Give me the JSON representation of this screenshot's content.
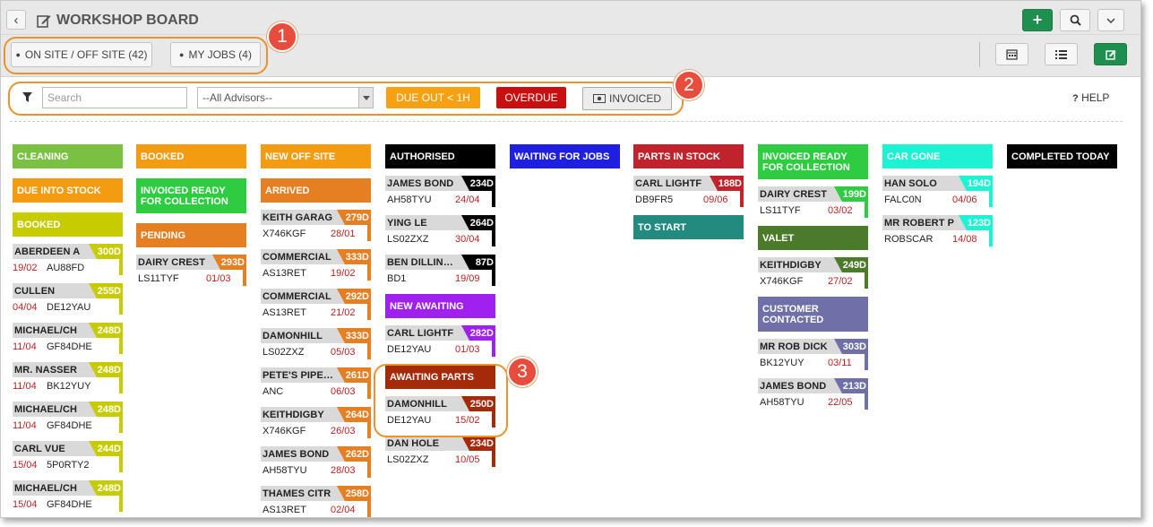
{
  "header": {
    "back_icon": "‹",
    "title": "WORKSHOP BOARD",
    "add_icon": "+",
    "search_icon": "⚲",
    "dropdown_icon": "⌄"
  },
  "tabs": {
    "onsite": "ON SITE / OFF SITE (42)",
    "myjobs": "MY JOBS (4)"
  },
  "view_icons": {
    "calendar": "calendar-icon",
    "list": "list-icon",
    "board": "board-icon"
  },
  "filters": {
    "search_placeholder": "Search",
    "advisors": "--All Advisors--",
    "due_out": "DUE OUT < 1H",
    "overdue": "OVERDUE",
    "invoiced": "INVOICED",
    "help": "HELP"
  },
  "callouts": [
    "1",
    "2",
    "3"
  ],
  "colors": {
    "lime": "#8bc34a",
    "orange": "#f39c12",
    "olive": "#c8c800",
    "green": "#2ecc40",
    "darkorange": "#e67e22",
    "black": "#000000",
    "blue": "#1f1fe0",
    "crimson": "#c0232b",
    "teal": "#238a80",
    "cyan": "#1ef2d4",
    "purple": "#a020f0",
    "darkred": "#a52a0a",
    "darkgreen": "#4a7a2a",
    "slate": "#7070a8"
  },
  "columns": [
    {
      "sections": [
        {
          "title": "CLEANING",
          "color": "#7ac143",
          "cards": []
        },
        {
          "title": "DUE INTO STOCK",
          "color": "#f39c12",
          "cards": []
        },
        {
          "title": "BOOKED",
          "color": "#c7cc00",
          "cards": [
            {
              "name": "ABERDEEN A",
              "days": "300D",
              "date": "19/02",
              "reg": "AU88FD",
              "date_first": true
            },
            {
              "name": "CULLEN",
              "days": "255D",
              "date": "04/04",
              "reg": "DE12YAU",
              "date_first": true
            },
            {
              "name": "MICHAEL/CH",
              "days": "248D",
              "date": "11/04",
              "reg": "GF84DHE",
              "date_first": true
            },
            {
              "name": "MR. NASSER",
              "days": "248D",
              "date": "11/04",
              "reg": "BK12YUY",
              "date_first": true
            },
            {
              "name": "MICHAEL/CH",
              "days": "248D",
              "date": "11/04",
              "reg": "GF84DHE",
              "date_first": true
            },
            {
              "name": "CARL VUE",
              "days": "244D",
              "date": "15/04",
              "reg": "5P0RTY2",
              "date_first": true
            },
            {
              "name": "MICHAEL/CH",
              "days": "248D",
              "date": "15/04",
              "reg": "GF84DHE",
              "date_first": true
            }
          ]
        }
      ]
    },
    {
      "sections": [
        {
          "title": "BOOKED",
          "color": "#f39c12",
          "cards": []
        },
        {
          "title": "INVOICED READY FOR COLLECTION",
          "color": "#2ecc40",
          "cards": []
        },
        {
          "title": "PENDING",
          "color": "#e67e22",
          "cards": [
            {
              "name": "DAIRY CREST",
              "days": "293D",
              "date": "01/03",
              "reg": "LS11TYF"
            }
          ]
        }
      ]
    },
    {
      "sections": [
        {
          "title": "NEW OFF SITE",
          "color": "#f39c12",
          "cards": []
        },
        {
          "title": "ARRIVED",
          "color": "#e67e22",
          "cards": [
            {
              "name": "KEITH GARAG",
              "days": "279D",
              "date": "28/01",
              "reg": "X746KGF"
            },
            {
              "name": "COMMERCIAL",
              "days": "333D",
              "date": "19/02",
              "reg": "AS13RET"
            },
            {
              "name": "COMMERCIAL",
              "days": "292D",
              "date": "21/02",
              "reg": "AS13RET"
            },
            {
              "name": "DAMONHILL",
              "days": "333D",
              "date": "05/03",
              "reg": "LS02ZXZ"
            },
            {
              "name": "PETE'S PIPERS",
              "days": "261D",
              "date": "06/03",
              "reg": "ANC"
            },
            {
              "name": "KEITHDIGBY",
              "days": "264D",
              "date": "26/03",
              "reg": "X746KGF"
            },
            {
              "name": "JAMES BOND",
              "days": "262D",
              "date": "28/03",
              "reg": "AH58TYU"
            },
            {
              "name": "THAMES CITR",
              "days": "258D",
              "date": "02/04",
              "reg": "AS13RET"
            }
          ]
        }
      ]
    },
    {
      "sections": [
        {
          "title": "AUTHORISED",
          "color": "#000000",
          "cards": [
            {
              "name": "JAMES BOND",
              "days": "234D",
              "date": "24/04",
              "reg": "AH58TYU"
            },
            {
              "name": "YING LE",
              "days": "264D",
              "date": "30/04",
              "reg": "LS02ZXZ"
            },
            {
              "name": "BEN DILLINGER",
              "days": "87D",
              "date": "19/09",
              "reg": "BD1"
            }
          ]
        },
        {
          "title": "NEW AWAITING",
          "color": "#a020f0",
          "cards": [
            {
              "name": "CARL LIGHTF",
              "days": "282D",
              "date": "01/03",
              "reg": "DE12YAU"
            }
          ]
        },
        {
          "title": "AWAITING PARTS",
          "color": "#a52a0a",
          "cards": [
            {
              "name": "DAMONHILL",
              "days": "250D",
              "date": "15/02",
              "reg": "DE12YAU"
            },
            {
              "name": "DAN HOLE",
              "days": "234D",
              "date": "10/05",
              "reg": "LS02ZXZ"
            }
          ]
        }
      ]
    },
    {
      "sections": [
        {
          "title": "WAITING FOR JOBS",
          "color": "#1f1fe0",
          "cards": []
        }
      ]
    },
    {
      "sections": [
        {
          "title": "PARTS IN STOCK",
          "color": "#c0232b",
          "cards": [
            {
              "name": "CARL LIGHTF",
              "days": "188D",
              "date": "09/06",
              "reg": "DB9FR5"
            }
          ]
        },
        {
          "title": "TO START",
          "color": "#238a80",
          "cards": []
        }
      ]
    },
    {
      "sections": [
        {
          "title": "INVOICED READY FOR COLLECTION",
          "color": "#2ecc40",
          "cards": [
            {
              "name": "DAIRY CREST",
              "days": "199D",
              "date": "03/02",
              "reg": "LS11TYF"
            }
          ]
        },
        {
          "title": "VALET",
          "color": "#4a7a2a",
          "cards": [
            {
              "name": "KEITHDIGBY",
              "days": "249D",
              "date": "27/02",
              "reg": "X746KGF"
            }
          ]
        },
        {
          "title": "CUSTOMER CONTACTED",
          "color": "#7070a8",
          "cards": [
            {
              "name": "MR ROB DICK",
              "days": "303D",
              "date": "03/11",
              "reg": "BK12YUY"
            },
            {
              "name": "JAMES BOND",
              "days": "213D",
              "date": "22/05",
              "reg": "AH58TYU"
            }
          ]
        }
      ]
    },
    {
      "sections": [
        {
          "title": "CAR GONE",
          "color": "#1ef2d4",
          "cards": [
            {
              "name": "HAN SOLO",
              "days": "194D",
              "date": "04/06",
              "reg": "FALC0N"
            },
            {
              "name": "MR ROBERT P",
              "days": "123D",
              "date": "14/08",
              "reg": "ROBSCAR"
            }
          ]
        }
      ]
    },
    {
      "sections": [
        {
          "title": "COMPLETED TODAY",
          "color": "#000000",
          "cards": []
        }
      ]
    }
  ]
}
